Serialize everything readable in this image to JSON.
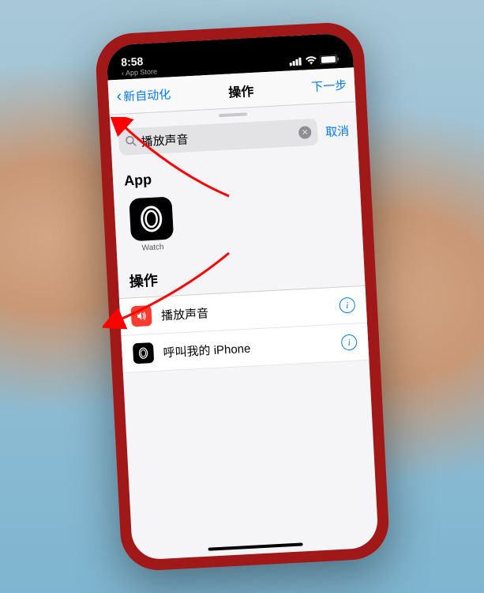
{
  "status": {
    "time": "8:58",
    "app_breadcrumb": "App Store"
  },
  "nav": {
    "back_label": "新自动化",
    "title": "操作",
    "next_label": "下一步"
  },
  "search": {
    "value": "播放声音",
    "cancel_label": "取消"
  },
  "sections": {
    "app": {
      "header": "App",
      "items": [
        {
          "label": "Watch",
          "icon": "watch"
        }
      ]
    },
    "actions": {
      "header": "操作",
      "items": [
        {
          "label": "播放声音",
          "icon": "speaker",
          "color": "#ff3b30"
        },
        {
          "label": "呼叫我的 iPhone",
          "icon": "watch",
          "color": "#000000"
        }
      ]
    }
  },
  "colors": {
    "accent": "#007aff",
    "destructive": "#ff3b30"
  }
}
